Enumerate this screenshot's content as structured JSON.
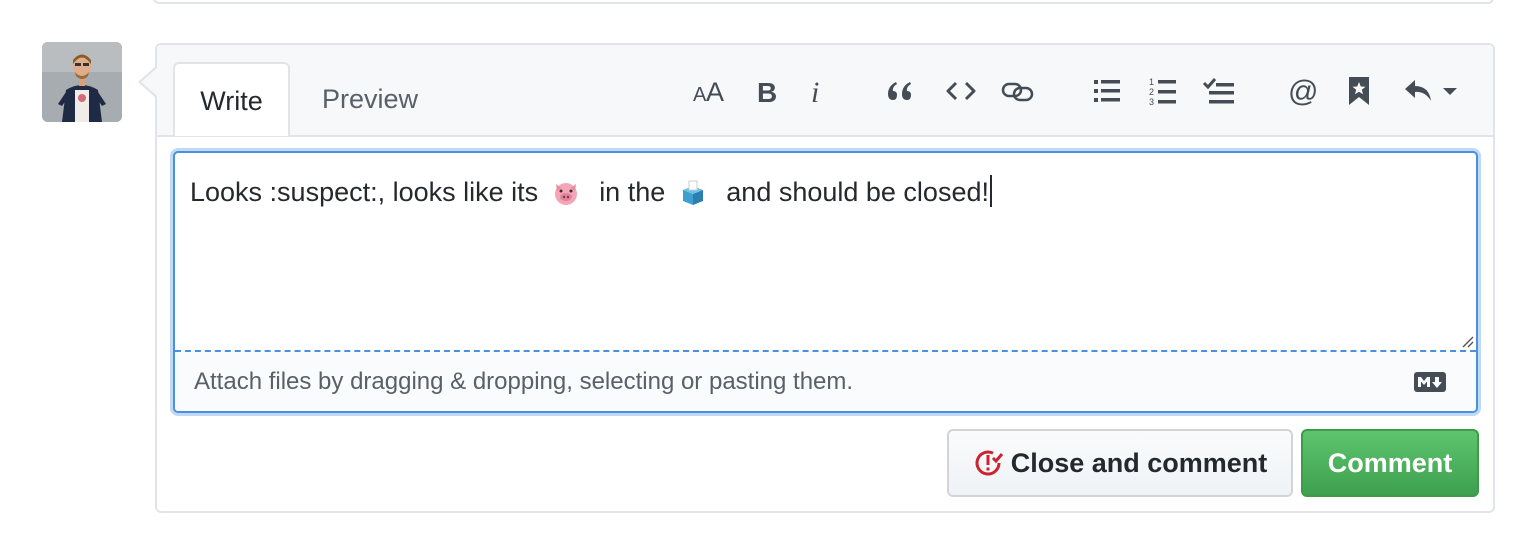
{
  "tabs": {
    "write": "Write",
    "preview": "Preview"
  },
  "toolbar_icons": [
    "text-size-icon",
    "bold-icon",
    "italic-icon",
    "quote-icon",
    "code-icon",
    "link-icon",
    "unordered-list-icon",
    "ordered-list-icon",
    "task-list-icon",
    "mention-icon",
    "saved-reply-icon",
    "reply-icon"
  ],
  "editor": {
    "text_before_pig": "Looks :suspect:, looks like its",
    "text_middle": "in the",
    "text_after_box": "and should be closed!",
    "emojis": [
      "pig-emoji",
      "ballot-box-emoji"
    ]
  },
  "dropzone": {
    "hint": "Attach files by dragging & dropping, selecting or pasting them.",
    "markdown_icon": "markdown-icon"
  },
  "buttons": {
    "close_and_comment": "Close and comment",
    "comment": "Comment"
  },
  "colors": {
    "focus_border": "#4a8fe0",
    "comment_green": "#3ea04f",
    "close_red": "#cb2431"
  }
}
